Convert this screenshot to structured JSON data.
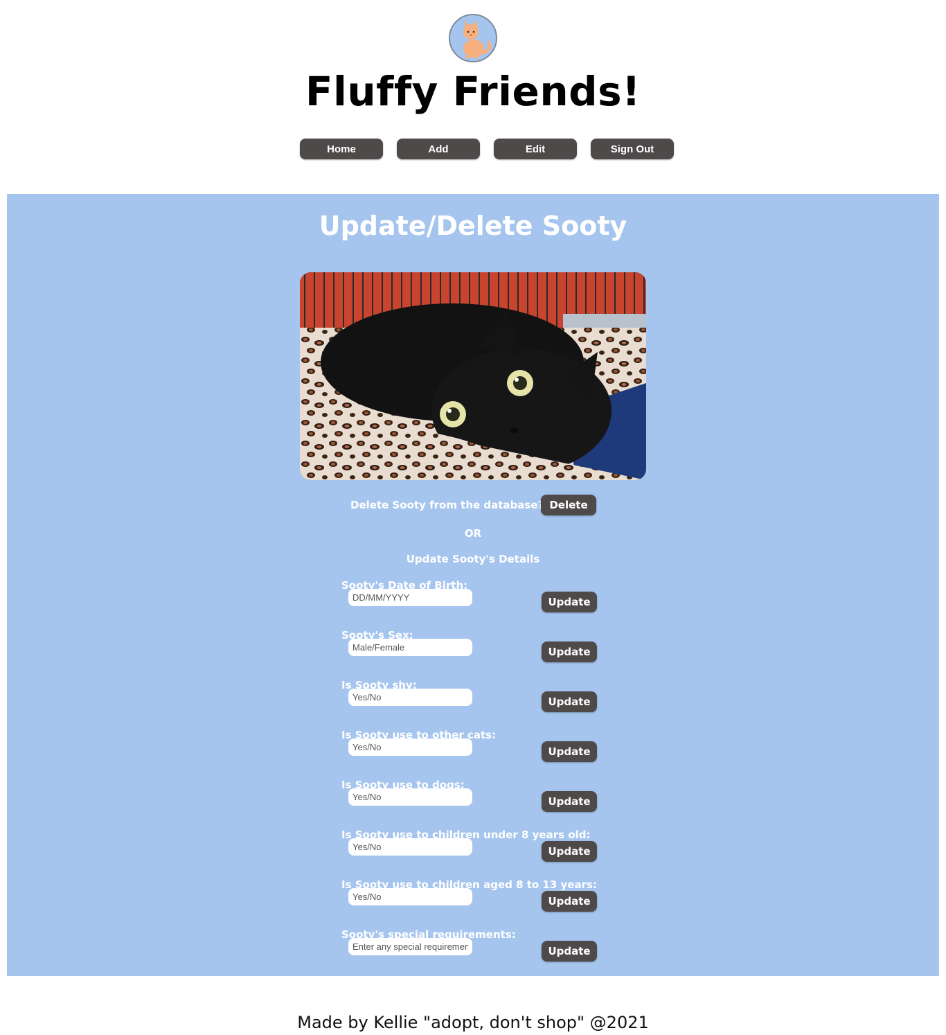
{
  "site": {
    "title": "Fluffy Friends!",
    "logo_icon": "cat-icon"
  },
  "nav": {
    "items": [
      {
        "label": "Home"
      },
      {
        "label": "Add"
      },
      {
        "label": "Edit"
      },
      {
        "label": "Sign Out"
      }
    ]
  },
  "panel": {
    "title": "Update/Delete Sooty",
    "photo_alt": "Sooty",
    "delete_prompt": "Delete Sooty from the database?",
    "delete_button": "Delete",
    "or_text": "OR",
    "update_heading": "Update Sooty's Details",
    "fields": [
      {
        "label": "Sooty's Date of Birth:",
        "placeholder": "DD/MM/YYYY",
        "value": "",
        "button": "Update"
      },
      {
        "label": "Sooty's Sex:",
        "placeholder": "Male/Female",
        "value": "",
        "button": "Update"
      },
      {
        "label": "Is Sooty shy:",
        "placeholder": "Yes/No",
        "value": "",
        "button": "Update"
      },
      {
        "label": "Is Sooty use to other cats:",
        "placeholder": "Yes/No",
        "value": "",
        "button": "Update"
      },
      {
        "label": "Is Sooty use to dogs:",
        "placeholder": "Yes/No",
        "value": "",
        "button": "Update"
      },
      {
        "label": "Is Sooty use to children under 8 years old:",
        "placeholder": "Yes/No",
        "value": "",
        "button": "Update"
      },
      {
        "label": "Is Sooty use to children aged 8 to 13 years:",
        "placeholder": "Yes/No",
        "value": "",
        "button": "Update"
      },
      {
        "label": "Sooty's special requirements:",
        "placeholder": "Enter any special requirements",
        "value": "",
        "button": "Update"
      }
    ]
  },
  "footer": {
    "text": "Made by Kellie \"adopt, don't shop\" @2021"
  },
  "colors": {
    "panel_bg": "#a5c5ee",
    "button_bg": "#4f4a4a",
    "text_on_panel": "#ffffff"
  }
}
